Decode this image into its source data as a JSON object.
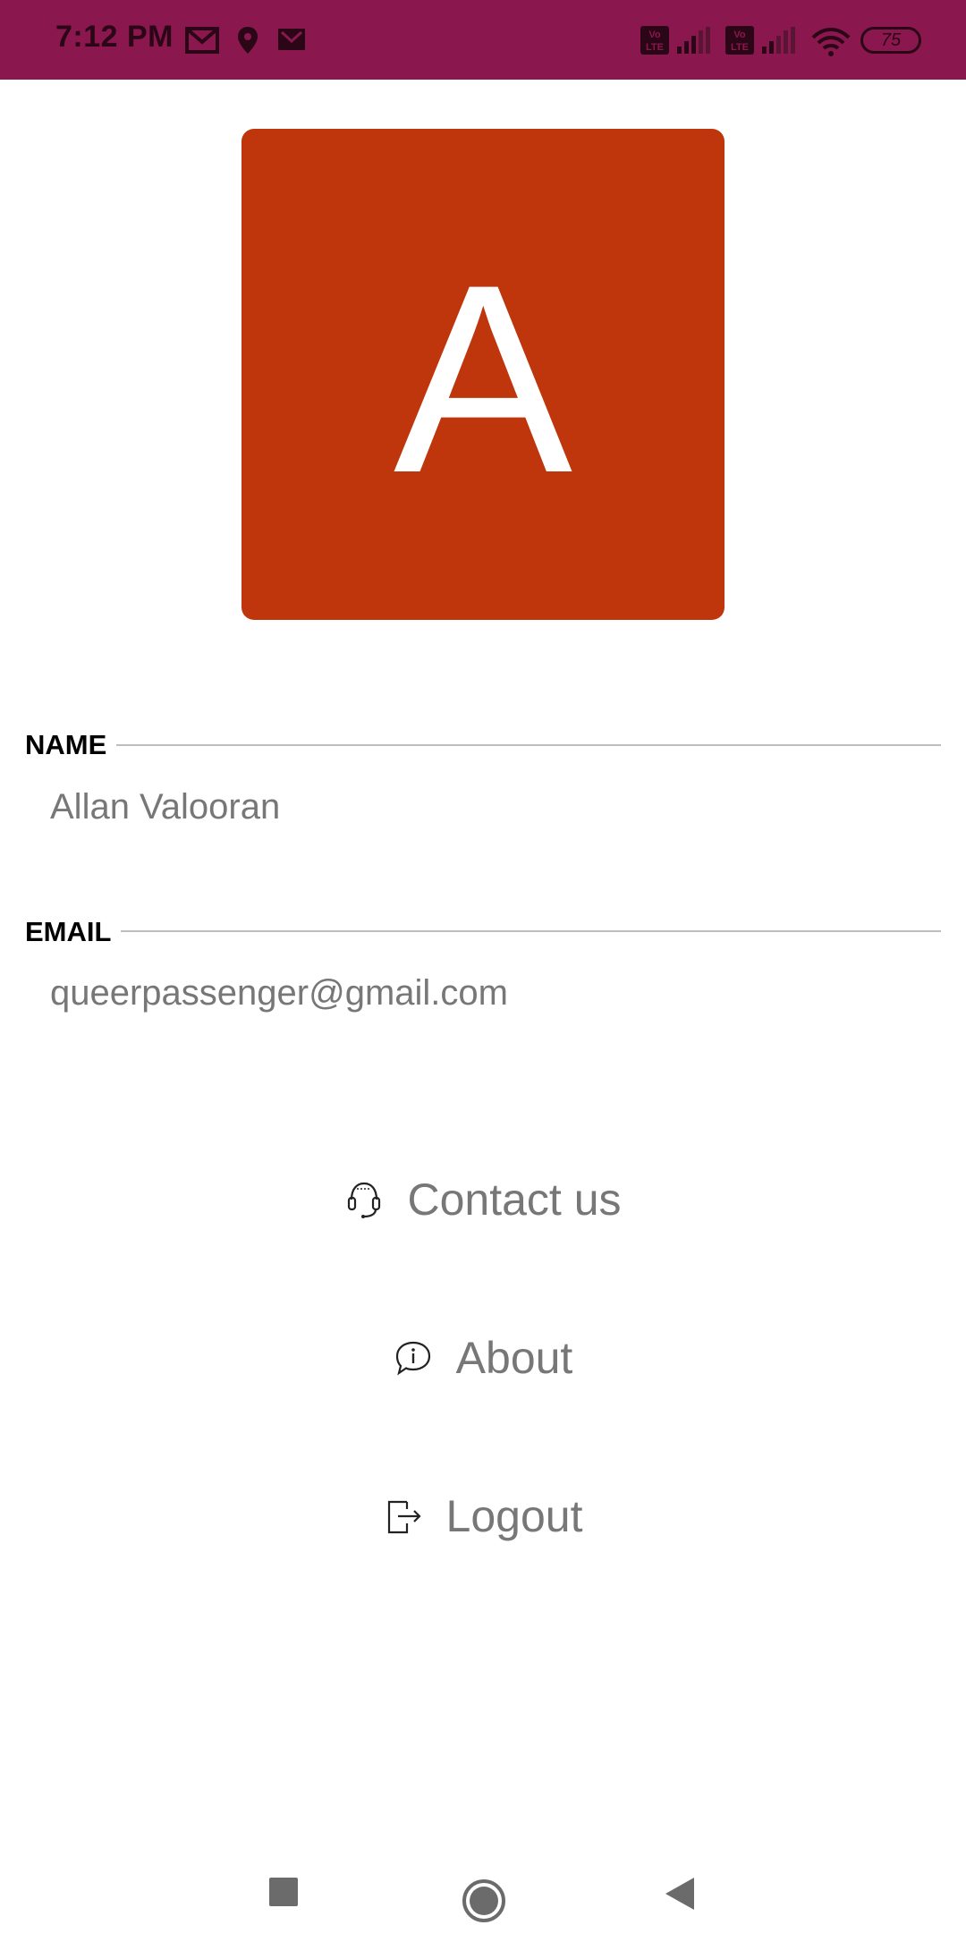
{
  "status_bar": {
    "time": "7:12 PM",
    "battery": "75",
    "icons": [
      "gmail-icon",
      "location-icon",
      "gmail-icon",
      "volte-icon",
      "signal-icon",
      "volte-icon",
      "signal-icon",
      "wifi-icon",
      "battery-icon"
    ]
  },
  "avatar": {
    "initial": "A",
    "color": "#bf360c"
  },
  "profile": {
    "name_label": "NAME",
    "name_value": "Allan Valooran",
    "email_label": "EMAIL",
    "email_value": "queerpassenger@gmail.com"
  },
  "menu": {
    "items": [
      {
        "label": "Contact us",
        "icon": "headset-icon"
      },
      {
        "label": "About",
        "icon": "info-bubble-icon"
      },
      {
        "label": "Logout",
        "icon": "logout-icon"
      }
    ]
  },
  "nav_bar": {
    "icons": [
      "recents-icon",
      "home-icon",
      "back-icon"
    ]
  },
  "colors": {
    "status_bar": "#8a174d",
    "avatar": "#bf360c",
    "label": "#000000",
    "value": "#777777"
  }
}
